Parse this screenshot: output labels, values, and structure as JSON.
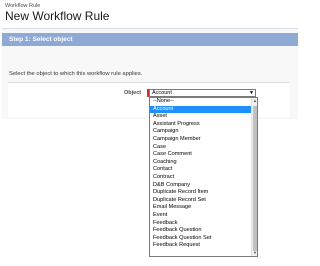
{
  "header": {
    "breadcrumb": "Workflow Rule",
    "title": "New Workflow Rule"
  },
  "step": {
    "title": "Step 1: Select object",
    "instruction": "Select the object to which this workflow rule applies."
  },
  "field": {
    "label": "Object",
    "selected_value": "Account"
  },
  "dropdown": {
    "options": [
      "--None--",
      "Account",
      "Asset",
      "Assistant Progress",
      "Campaign",
      "Campaign Member",
      "Case",
      "Case Comment",
      "Coaching",
      "Contact",
      "Contract",
      "D&B Company",
      "Duplicate Record Item",
      "Duplicate Record Set",
      "Email Message",
      "Event",
      "Feedback",
      "Feedback Question",
      "Feedback Question Set",
      "Feedback Request"
    ],
    "highlighted_index": 1
  },
  "colors": {
    "step_bar": "#8ea9d4",
    "highlight": "#1e90ff",
    "required": "#c23934"
  }
}
